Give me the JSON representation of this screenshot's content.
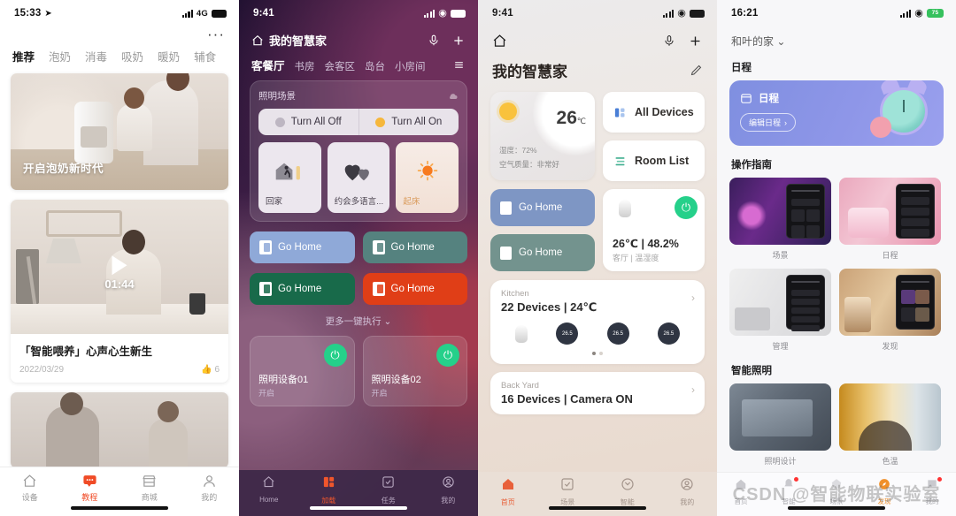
{
  "panel1": {
    "status": {
      "time": "15:33",
      "location_icon": "location-arrow-icon",
      "network": "4G"
    },
    "overflow": "···",
    "tabs": [
      {
        "label": "推荐",
        "active": true
      },
      {
        "label": "泡奶",
        "active": false
      },
      {
        "label": "消毒",
        "active": false
      },
      {
        "label": "吸奶",
        "active": false
      },
      {
        "label": "暖奶",
        "active": false
      },
      {
        "label": "辅食",
        "active": false
      }
    ],
    "hero_caption": "开启泡奶新时代",
    "video": {
      "duration": "01:44",
      "title": "「智能喂养」心声心生新生",
      "date": "2022/03/29",
      "likes": "6"
    },
    "tabbar": [
      {
        "label": "设备",
        "icon": "home-icon",
        "active": false
      },
      {
        "label": "教程",
        "icon": "tutorial-icon",
        "active": true
      },
      {
        "label": "商城",
        "icon": "store-icon",
        "active": false
      },
      {
        "label": "我的",
        "icon": "person-icon",
        "active": false
      }
    ]
  },
  "panel2": {
    "status": {
      "time": "9:41"
    },
    "header": {
      "title": "我的智慧家",
      "home_icon": "home-icon",
      "mic_icon": "microphone-icon",
      "plus_icon": "plus-icon"
    },
    "rooms": [
      {
        "label": "客餐厅",
        "active": true
      },
      {
        "label": "书房",
        "active": false
      },
      {
        "label": "会客区",
        "active": false
      },
      {
        "label": "岛台",
        "active": false
      },
      {
        "label": "小房间",
        "active": false
      }
    ],
    "menu_icon": "hamburger-icon",
    "scene_card": {
      "title": "照明场景",
      "toggle_off": "Turn All Off",
      "toggle_on": "Turn All On",
      "scenes": [
        {
          "label": "回家",
          "icon": "walking-home-icon"
        },
        {
          "label": "约会多语言...",
          "icon": "hearts-icon"
        },
        {
          "label": "起床",
          "icon": "sun-icon"
        }
      ]
    },
    "quick_actions": [
      {
        "label": "Go Home",
        "color": "#8fa9d8"
      },
      {
        "label": "Go Home",
        "color": "#55827f"
      },
      {
        "label": "Go Home",
        "color": "#186a4a"
      },
      {
        "label": "Go Home",
        "color": "#e03e17"
      }
    ],
    "more_label": "更多一键执行",
    "devices": [
      {
        "name": "照明设备01",
        "state": "开启",
        "icon": "bulb-icon"
      },
      {
        "name": "照明设备02",
        "state": "开启",
        "icon": "bulb-icon"
      }
    ],
    "tabbar": [
      {
        "label": "Home",
        "icon": "home-icon",
        "active": false
      },
      {
        "label": "加载",
        "icon": "grid-icon",
        "active": true
      },
      {
        "label": "任务",
        "icon": "check-square-icon",
        "active": false
      },
      {
        "label": "我的",
        "icon": "person-circle-icon",
        "active": false
      }
    ]
  },
  "panel3": {
    "status": {
      "time": "9:41"
    },
    "header": {
      "home_icon": "home-icon",
      "mic_icon": "microphone-icon",
      "plus_icon": "plus-icon"
    },
    "title": "我的智慧家",
    "edit_icon": "pencil-icon",
    "weather": {
      "temp": "26",
      "unit": "℃",
      "humidity": "湿度：72%",
      "air": "空气质量：非常好",
      "icon": "sun-icon"
    },
    "pills": [
      {
        "label": "All Devices",
        "icon": "devices-icon"
      },
      {
        "label": "Room List",
        "icon": "list-icon"
      }
    ],
    "quick_actions": [
      {
        "label": "Go Home",
        "color": "#7e96c4"
      },
      {
        "label": "Go Home",
        "color": "#73938e"
      }
    ],
    "sensor": {
      "value": "26℃ | 48.2%",
      "sub": "客厅 | 温湿度",
      "icon": "bulb-icon",
      "power_icon": "power-icon"
    },
    "rooms": [
      {
        "name": "Kitchen",
        "info": "22 Devices  |  24℃",
        "knobs": [
          "26.5",
          "26.5",
          "26.5"
        ]
      },
      {
        "name": "Back Yard",
        "info": "16 Devices  |  Camera ON",
        "knobs": []
      }
    ],
    "tabbar": [
      {
        "label": "首页",
        "icon": "home-icon",
        "active": true
      },
      {
        "label": "场景",
        "icon": "check-square-icon",
        "active": false
      },
      {
        "label": "智能",
        "icon": "clock-icon",
        "active": false
      },
      {
        "label": "我的",
        "icon": "person-circle-icon",
        "active": false
      }
    ]
  },
  "panel4": {
    "status": {
      "time": "16:21",
      "battery": "75"
    },
    "home_selector": "和叶的家",
    "section_schedule": "日程",
    "schedule_card": {
      "label": "日程",
      "button": "编辑日程",
      "icon": "calendar-icon",
      "art": "alarm-clock-icon"
    },
    "section_guide": "操作指南",
    "guide_items": [
      {
        "label": "场景"
      },
      {
        "label": "日程"
      },
      {
        "label": "管理"
      },
      {
        "label": "发现"
      }
    ],
    "section_lighting": "智能照明",
    "lighting_items": [
      {
        "label": "照明设计"
      },
      {
        "label": "色温"
      }
    ],
    "tabbar": [
      {
        "label": "首页",
        "icon": "home-icon",
        "active": false
      },
      {
        "label": "智能",
        "icon": "bell-icon",
        "active": false
      },
      {
        "label": "场景",
        "icon": "pentagon-icon",
        "active": false
      },
      {
        "label": "发现",
        "icon": "compass-icon",
        "active": true
      },
      {
        "label": "我的",
        "icon": "message-icon",
        "active": false
      }
    ],
    "watermark": "CSDN @智能物联实验室"
  }
}
